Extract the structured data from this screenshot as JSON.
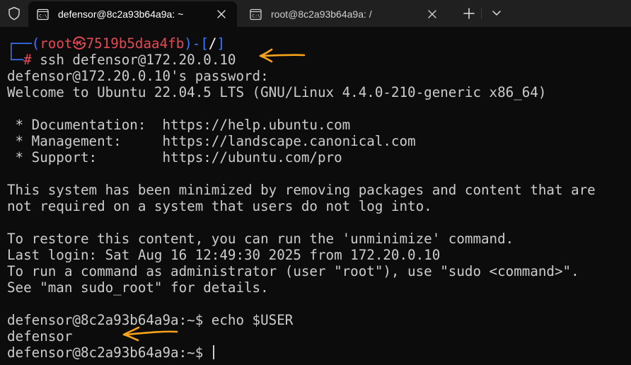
{
  "tabs": [
    {
      "title": "defensor@8c2a93b64a9a: ~",
      "active": true,
      "icon": "terminal-icon"
    },
    {
      "title": "root@8c2a93b64a9a: /",
      "active": false,
      "icon": "terminal-icon"
    }
  ],
  "toolbar": {
    "new_tab_icon": "plus-icon",
    "dropdown_icon": "chevron-down-icon",
    "shield_icon": "shield-icon"
  },
  "terminal": {
    "kali_prompt": {
      "top_left": "┌──(",
      "user": "root",
      "at_symbol": "㉿",
      "host": "7519b5daa4fb",
      "close_paren": ")-[",
      "cwd": "/",
      "close_bracket": "]",
      "bottom_left": "└─",
      "hash": "#",
      "command": " ssh defensor@172.20.0.10"
    },
    "lines": [
      "defensor@172.20.0.10's password:",
      "Welcome to Ubuntu 22.04.5 LTS (GNU/Linux 4.4.0-210-generic x86_64)",
      "",
      " * Documentation:  https://help.ubuntu.com",
      " * Management:     https://landscape.canonical.com",
      " * Support:        https://ubuntu.com/pro",
      "",
      "This system has been minimized by removing packages and content that are",
      "not required on a system that users do not log into.",
      "",
      "To restore this content, you can run the 'unminimize' command.",
      "Last login: Sat Aug 16 12:49:30 2025 from 172.20.0.10",
      "To run a command as administrator (user \"root\"), use \"sudo <command>\".",
      "See \"man sudo_root\" for details.",
      "",
      "defensor@8c2a93b64a9a:~$ echo $USER",
      "defensor",
      "defensor@8c2a93b64a9a:~$ "
    ]
  },
  "colors": {
    "prompt_blue": "#3b78ff",
    "prompt_red": "#e74856",
    "annotation_orange": "#f7a21b",
    "terminal_bg": "#0c0c0c",
    "tabbar_bg": "#202020"
  }
}
